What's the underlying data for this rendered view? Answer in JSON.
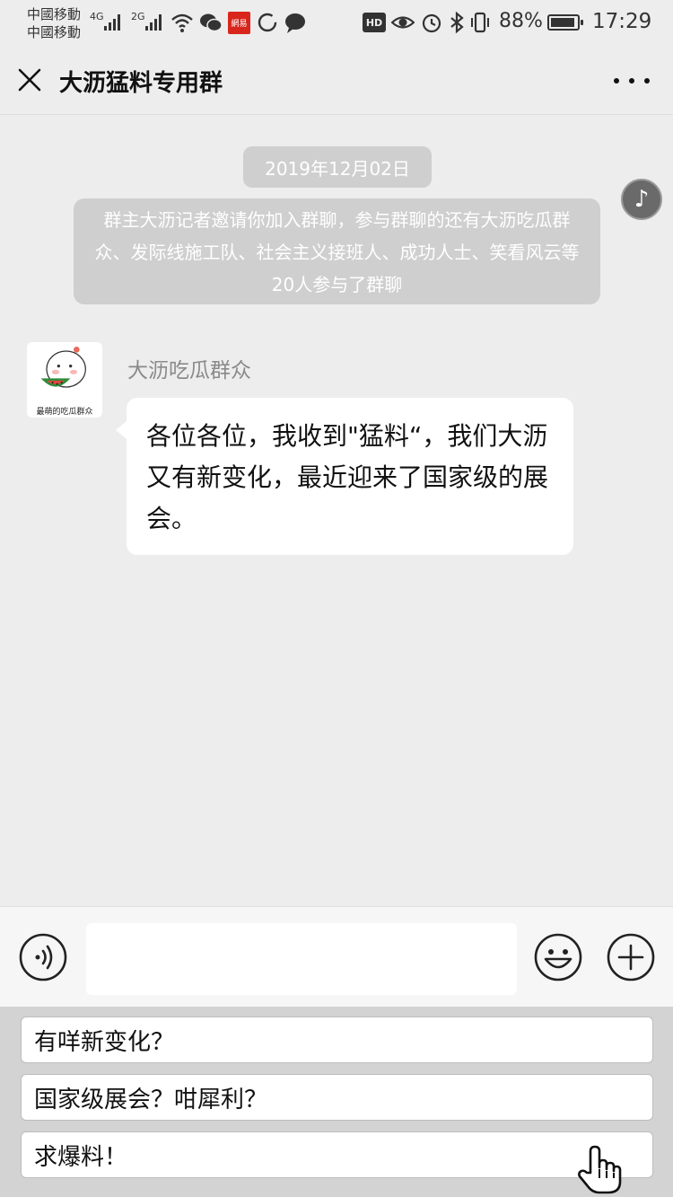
{
  "status_bar": {
    "carrier_1": "中國移動",
    "carrier_2": "中國移動",
    "net_1": "4G",
    "net_2": "2G",
    "app_badge": "網易",
    "hd_label": "HD",
    "battery_percent": "88%",
    "time": "17:29"
  },
  "header": {
    "title": "大沥猛料专用群"
  },
  "chat": {
    "date": "2019年12月02日",
    "system_message": "群主大沥记者邀请你加入群聊，参与群聊的还有大沥吃瓜群众、发际线施工队、社会主义接班人、成功人士、笑看风云等20人参与了群聊",
    "messages": [
      {
        "sender": "大沥吃瓜群众",
        "avatar_caption": "最萌的吃瓜群众",
        "text": "各位各位，我收到\"猛料“，我们大沥又有新变化，最近迎来了国家级的展会。"
      }
    ]
  },
  "input": {
    "value": "",
    "placeholder": ""
  },
  "quick_replies": [
    "有咩新变化？",
    "国家级展会？咁犀利？",
    "求爆料！"
  ]
}
